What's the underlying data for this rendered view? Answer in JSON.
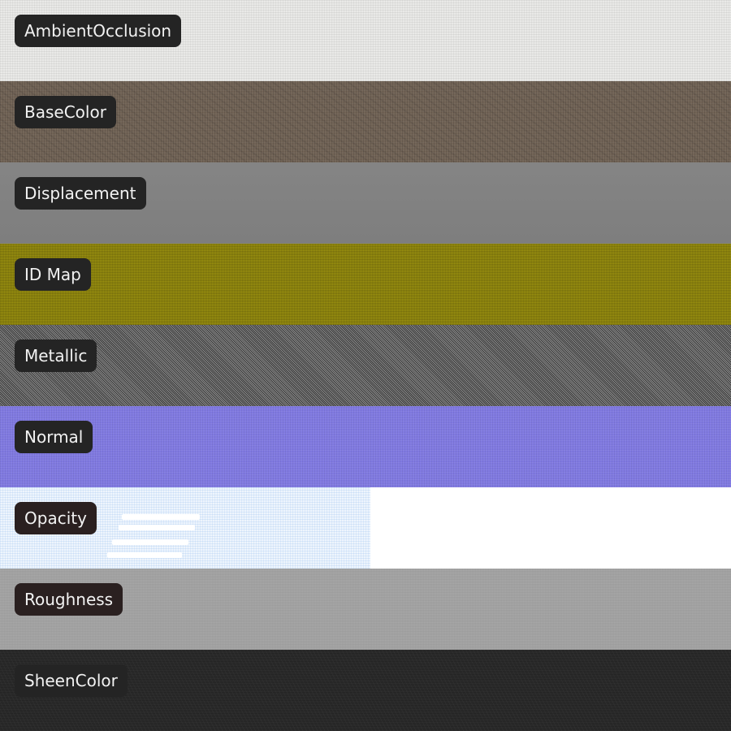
{
  "maps": [
    {
      "label": "AmbientOcclusion"
    },
    {
      "label": "BaseColor"
    },
    {
      "label": "Displacement"
    },
    {
      "label": "ID Map"
    },
    {
      "label": "Metallic"
    },
    {
      "label": "Normal"
    },
    {
      "label": "Opacity"
    },
    {
      "label": "Roughness"
    },
    {
      "label": "SheenColor"
    }
  ]
}
